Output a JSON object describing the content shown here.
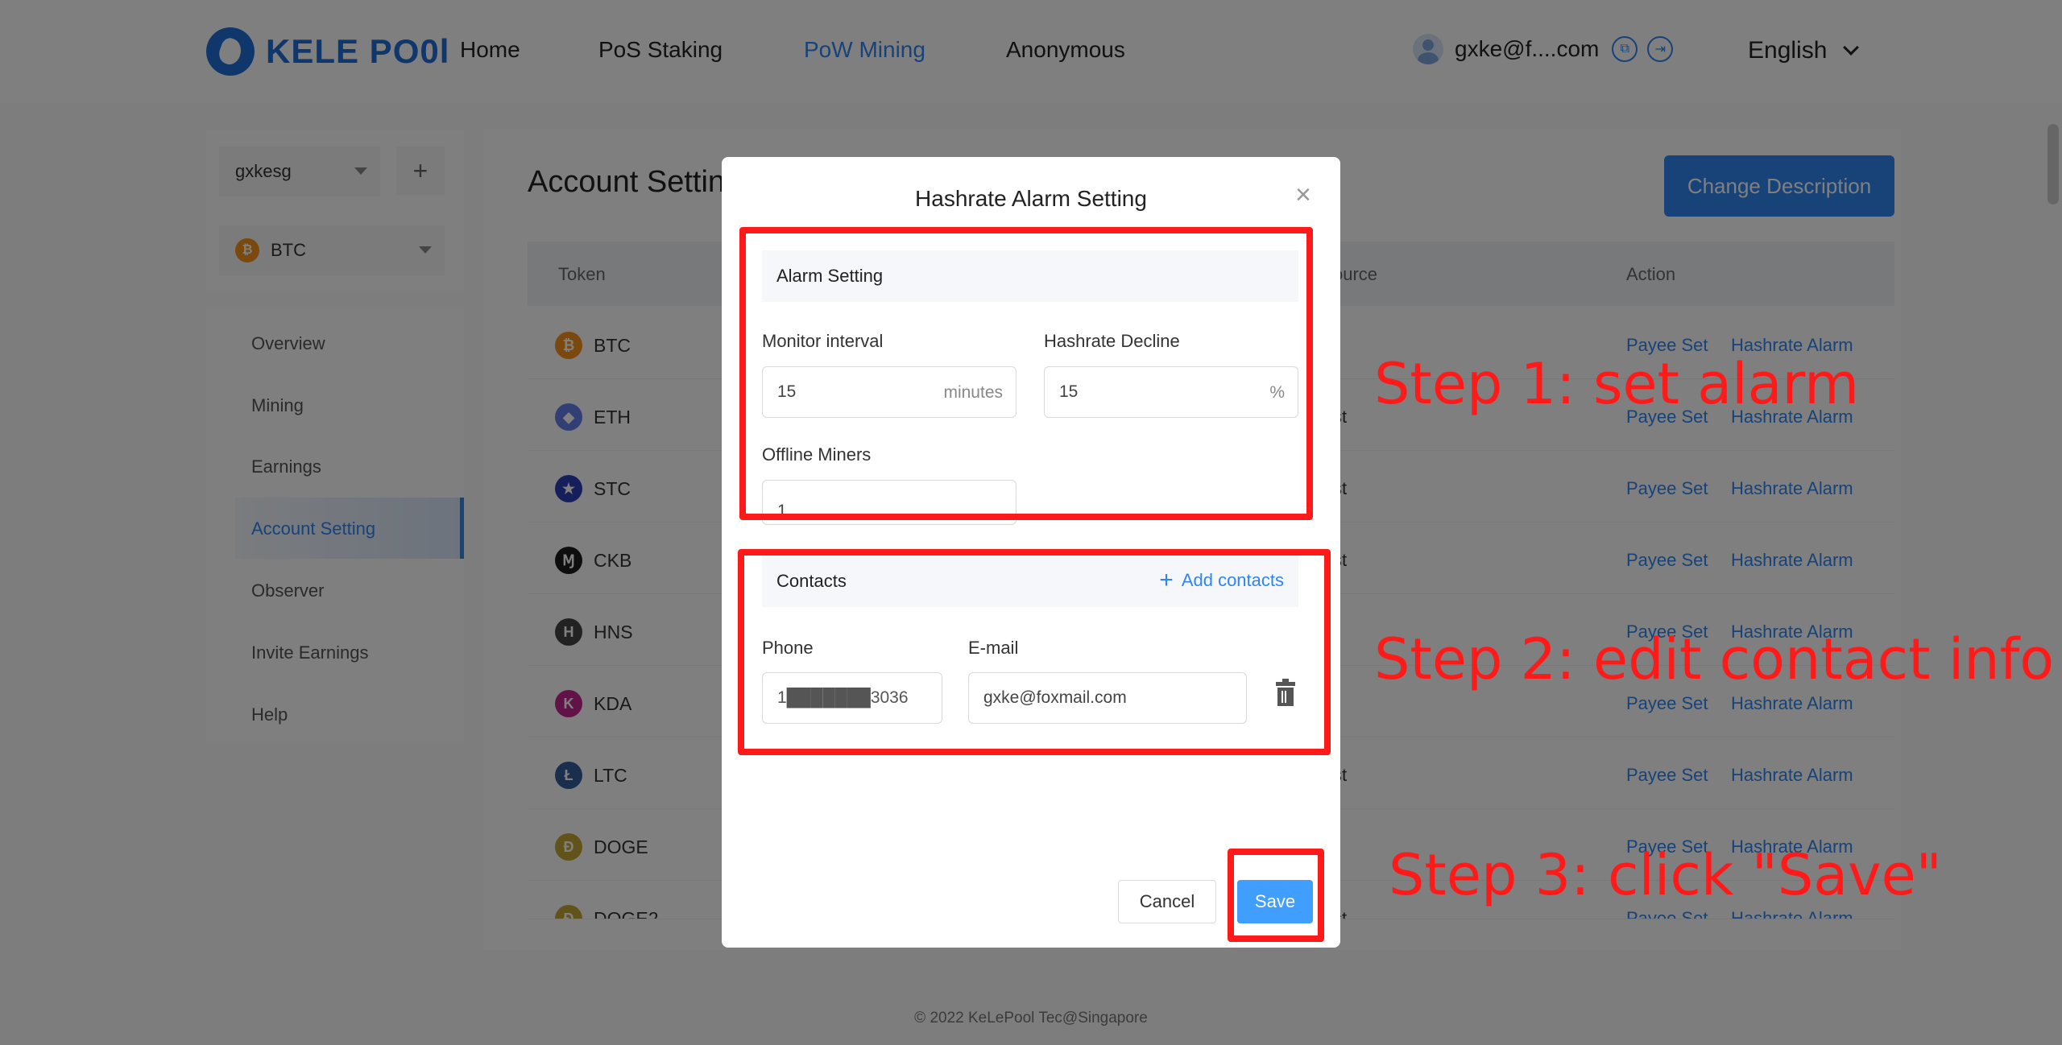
{
  "brand": {
    "logo_text": "KELE PO0l"
  },
  "nav": {
    "home": "Home",
    "pos": "PoS Staking",
    "pow": "PoW Mining",
    "anon": "Anonymous"
  },
  "user": {
    "email": "gxke@f....com"
  },
  "language": "English",
  "sidebar": {
    "account": "gxkesg",
    "coin": "BTC",
    "items": [
      {
        "label": "Overview"
      },
      {
        "label": "Mining"
      },
      {
        "label": "Earnings"
      },
      {
        "label": "Account Setting"
      },
      {
        "label": "Observer"
      },
      {
        "label": "Invite Earnings"
      },
      {
        "label": "Help"
      }
    ]
  },
  "main": {
    "title": "Account Settin",
    "change_description": "Change Description"
  },
  "table": {
    "headers": {
      "token": "Token",
      "source": "ource",
      "action": "Action"
    },
    "payee_label": "Payee Set",
    "alarm_label": "Hashrate Alarm",
    "rows": [
      {
        "token": "BTC",
        "color": "#f7931a",
        "glyph": "₿",
        "source": ""
      },
      {
        "token": "ETH",
        "color": "#627eea",
        "glyph": "◆",
        "source": "st"
      },
      {
        "token": "STC",
        "color": "#2b3fb6",
        "glyph": "★",
        "source": "st"
      },
      {
        "token": "CKB",
        "color": "#1d1d1d",
        "glyph": "Ɱ",
        "source": "st"
      },
      {
        "token": "HNS",
        "color": "#444444",
        "glyph": "H",
        "source": ""
      },
      {
        "token": "KDA",
        "color": "#c2278f",
        "glyph": "K",
        "source": ""
      },
      {
        "token": "LTC",
        "color": "#345d9d",
        "glyph": "Ł",
        "source": "st"
      },
      {
        "token": "DOGE",
        "color": "#c2a633",
        "glyph": "Ð",
        "source": ""
      },
      {
        "token": "DOGE2",
        "color": "#c2a633",
        "glyph": "Ð",
        "source": "st"
      }
    ]
  },
  "modal": {
    "title": "Hashrate Alarm Setting",
    "alarm_section": "Alarm Setting",
    "monitor_label": "Monitor interval",
    "monitor_value": "15",
    "monitor_unit": "minutes",
    "decline_label": "Hashrate Decline",
    "decline_value": "15",
    "decline_unit": "%",
    "offline_label": "Offline Miners",
    "offline_value": "1",
    "contacts_section": "Contacts",
    "add_contacts": "Add contacts",
    "phone_label": "Phone",
    "phone_value": "1███████3036",
    "email_label": "E-mail",
    "email_value": "gxke@foxmail.com",
    "cancel": "Cancel",
    "save": "Save"
  },
  "annotations": {
    "step1": "Step 1: set alarm",
    "step2": "Step 2: edit contact info",
    "step3": "Step 3: click \"Save\"",
    "color": "#ff1a1a"
  },
  "footer": "© 2022 KeLePool Tec@Singapore"
}
